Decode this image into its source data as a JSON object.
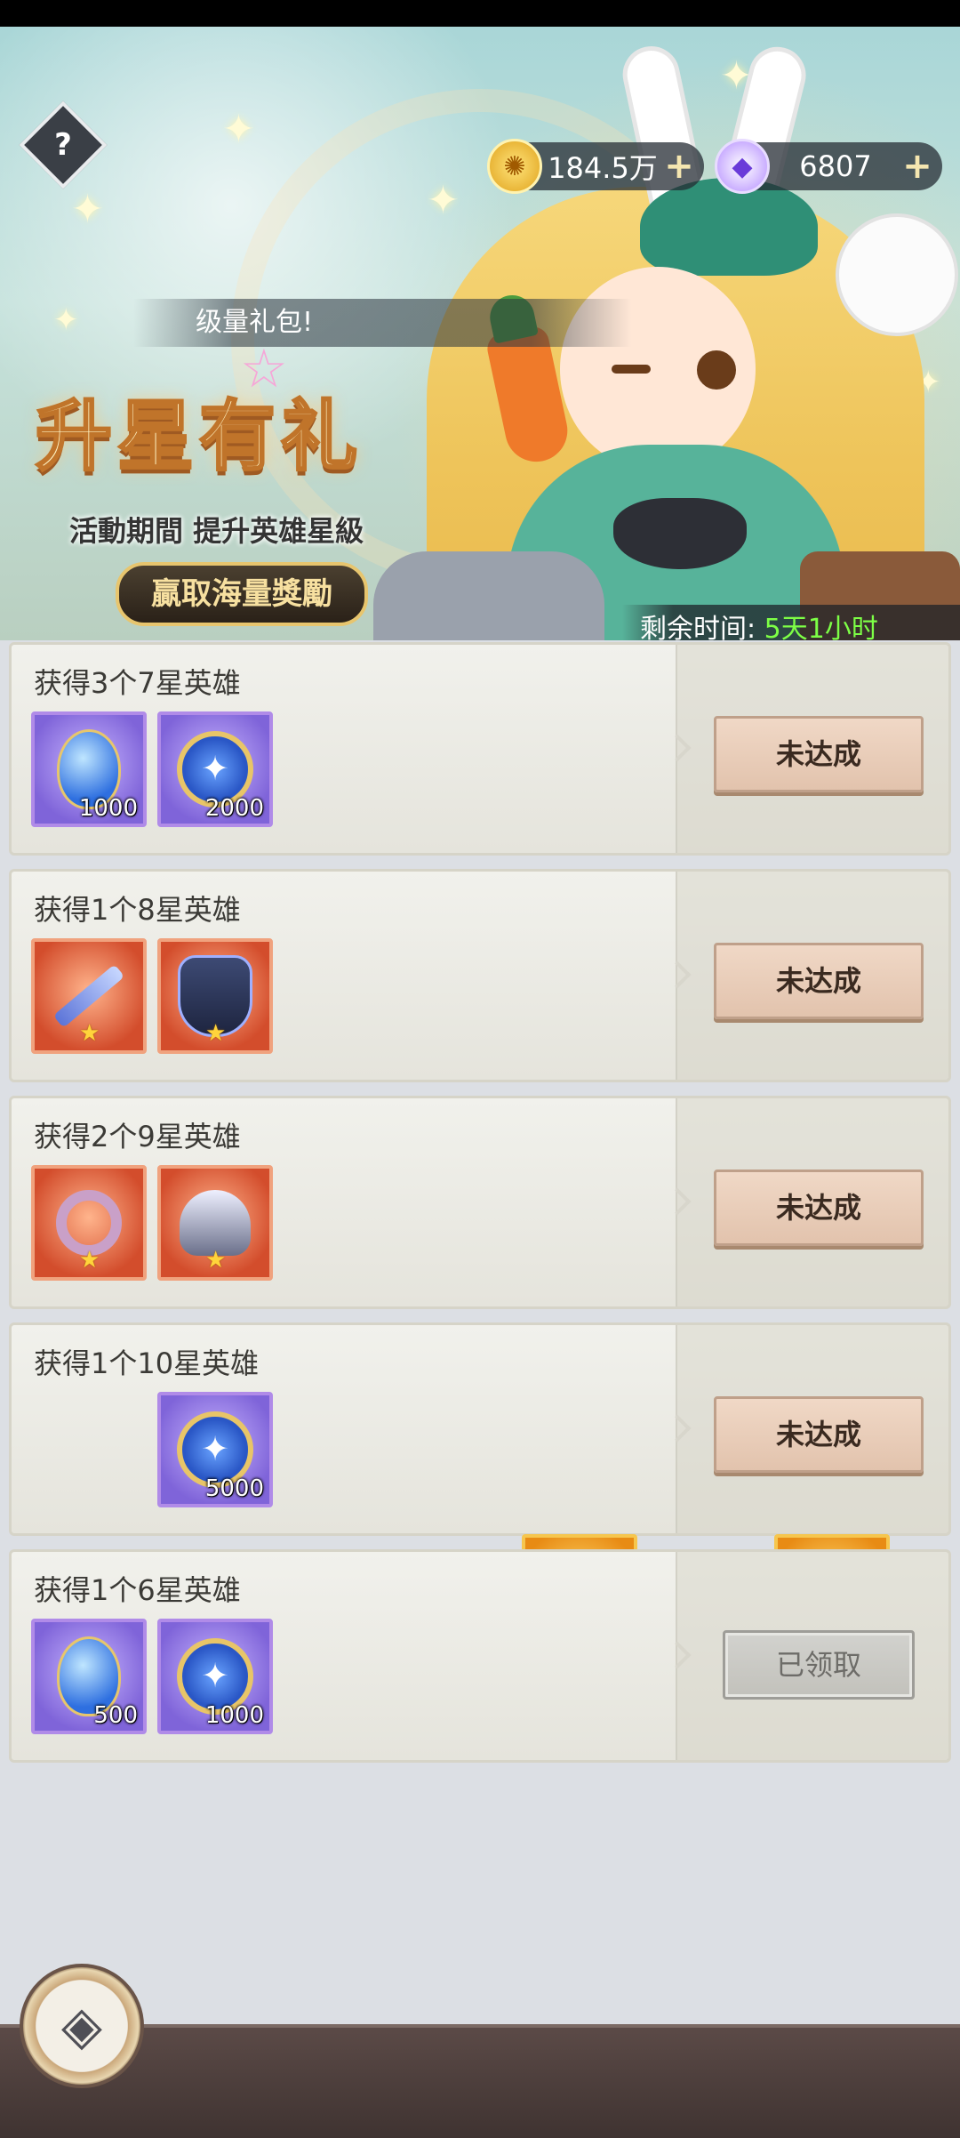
{
  "currency": {
    "gold_value": "184.5万",
    "gem_value": "6807",
    "gold_icon": "gold-coin-icon",
    "gem_icon": "diamond-icon",
    "plus": "+"
  },
  "help": {
    "label": "?"
  },
  "banner": {
    "marquee": "级量礼包!",
    "title": "升星有礼",
    "subtitle": "活動期間 提升英雄星級",
    "reward_pill": "贏取海量獎勵",
    "timer_label": "剩余时间:",
    "timer_value": "5天1小时"
  },
  "tasks": [
    {
      "title": "获得3个7星英雄",
      "items": [
        {
          "icon": "blue-egg-icon",
          "count": "1000",
          "rarity": "purple"
        },
        {
          "icon": "star-medal-icon",
          "count": "2000",
          "rarity": "purple"
        }
      ],
      "button": "未达成"
    },
    {
      "title": "获得1个8星英雄",
      "items": [
        {
          "icon": "weapon-icon",
          "count": "",
          "rarity": "red"
        },
        {
          "icon": "armor-icon",
          "count": "",
          "rarity": "red"
        }
      ],
      "button": "未达成"
    },
    {
      "title": "获得2个9星英雄",
      "items": [
        {
          "icon": "ring-icon",
          "count": "",
          "rarity": "red"
        },
        {
          "icon": "helm-icon",
          "count": "",
          "rarity": "red"
        }
      ],
      "button": "未达成"
    },
    {
      "title": "获得1个10星英雄",
      "items": [
        {
          "icon": "swirl-emblem-icon",
          "count": "",
          "rarity": "gold"
        },
        {
          "icon": "star-medal-icon",
          "count": "5000",
          "rarity": "purple"
        },
        {
          "icon": "gold-frame-icon",
          "count": "",
          "rarity": "gold"
        }
      ],
      "button": "未达成"
    },
    {
      "title": "获得1个6星英雄",
      "items": [
        {
          "icon": "blue-egg-icon",
          "count": "500",
          "rarity": "purple"
        },
        {
          "icon": "star-medal-icon",
          "count": "1000",
          "rarity": "purple"
        }
      ],
      "button": "已领取",
      "claimed": true
    }
  ],
  "nav": {
    "back_icon": "back-arrow-icon"
  },
  "colors": {
    "timer_green": "#7dff46",
    "button_bg": "#e8ccb8",
    "claimed_bg": "#c9c8c3"
  }
}
